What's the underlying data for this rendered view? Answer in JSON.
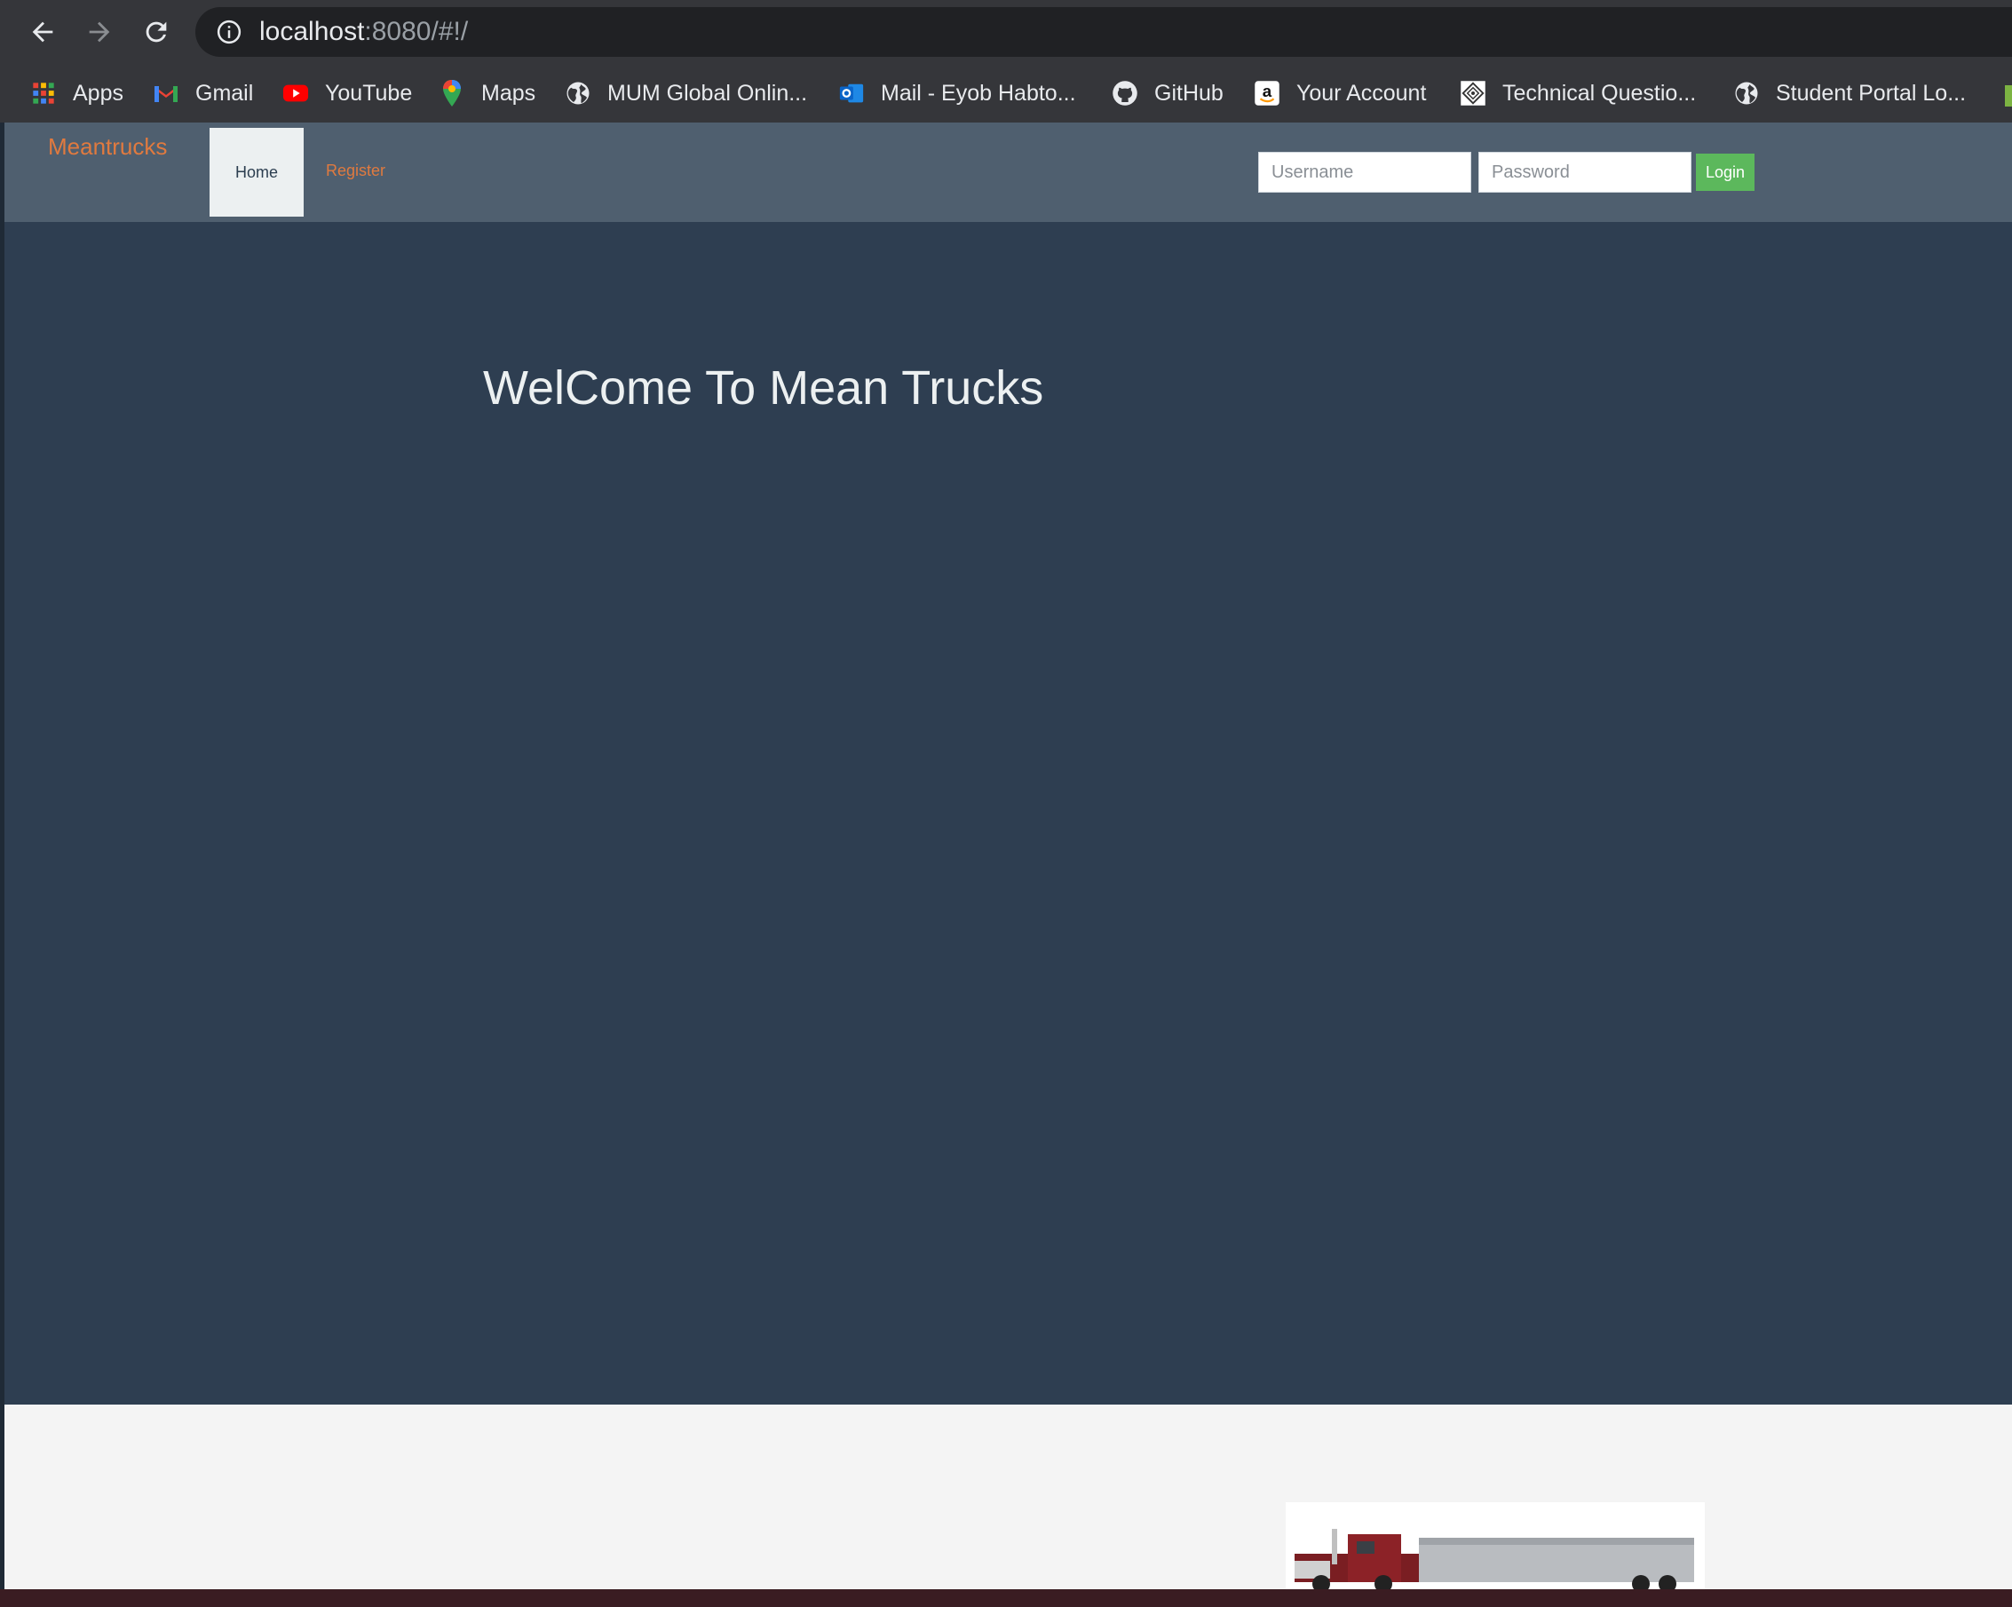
{
  "browser": {
    "url_host": "localhost",
    "url_rest": ":8080/#!/",
    "bookmarks": [
      {
        "label": "Apps",
        "icon": "apps-grid-icon"
      },
      {
        "label": "Gmail",
        "icon": "gmail-icon"
      },
      {
        "label": "YouTube",
        "icon": "youtube-icon"
      },
      {
        "label": "Maps",
        "icon": "maps-pin-icon"
      },
      {
        "label": "MUM Global Onlin...",
        "icon": "globe-icon"
      },
      {
        "label": "Mail - Eyob Habto...",
        "icon": "outlook-icon"
      },
      {
        "label": "GitHub",
        "icon": "github-icon"
      },
      {
        "label": "Your Account",
        "icon": "amazon-icon"
      },
      {
        "label": "Technical Questio...",
        "icon": "site-favicon-icon"
      },
      {
        "label": "Student Portal Lo...",
        "icon": "globe-icon"
      }
    ]
  },
  "navbar": {
    "brand": "Meantrucks",
    "home": "Home",
    "register": "Register",
    "username_placeholder": "Username",
    "password_placeholder": "Password",
    "login": "Login"
  },
  "main": {
    "title": "WelCome To Mean Trucks"
  },
  "colors": {
    "navbar_bg": "#4f5f6f",
    "page_bg": "#2e3e51",
    "brand": "#e07a3f",
    "login_button": "#5cb85c"
  }
}
